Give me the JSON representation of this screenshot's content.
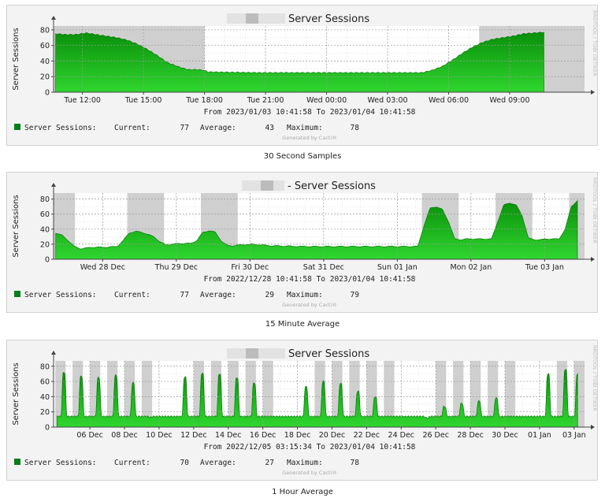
{
  "colors": {
    "area_light": "#2fd62f",
    "area_dark": "#0a8f0a",
    "legend_swatch": "#00801a",
    "night_shade": "#cfcfcf",
    "grid": "#bdbdbd",
    "axis": "#444444"
  },
  "chart_data": [
    {
      "type": "area",
      "title": "Server Sessions",
      "ylabel": "Server Sessions",
      "side_label": "RRDTOOL / TOBI OETIKER",
      "ylim": [
        0,
        85
      ],
      "yticks": [
        0,
        20,
        40,
        60,
        80
      ],
      "xlim_hours": [
        -24.1,
        2.0
      ],
      "xticks": [
        {
          "t": -22.68,
          "label": "Tue 12:00"
        },
        {
          "t": -19.68,
          "label": "Tue 15:00"
        },
        {
          "t": -16.68,
          "label": "Tue 18:00"
        },
        {
          "t": -13.68,
          "label": "Tue 21:00"
        },
        {
          "t": -10.68,
          "label": "Wed 00:00"
        },
        {
          "t": -7.68,
          "label": "Wed 03:00"
        },
        {
          "t": -4.68,
          "label": "Wed 06:00"
        },
        {
          "t": -1.68,
          "label": "Wed 09:00"
        }
      ],
      "minor_step": 1,
      "shade": [
        [
          -24.1,
          -16.68
        ],
        [
          -3.18,
          2.0
        ]
      ],
      "series": [
        {
          "x": [
            -24.0,
            -23.5,
            -23.0,
            -22.5,
            -22.0,
            -21.5,
            -21.0,
            -20.5,
            -20.0,
            -19.5,
            -19.0,
            -18.5,
            -18.0,
            -17.5,
            -17.0,
            -16.7,
            -16.5,
            -14.0,
            -11.0,
            -8.0,
            -6.5,
            -6.0,
            -5.5,
            -5.0,
            -4.5,
            -4.0,
            -3.5,
            -3.0,
            -2.5,
            -2.0,
            -1.5,
            -1.0,
            0.0
          ],
          "values": [
            75,
            74,
            74,
            76,
            74,
            72,
            70,
            67,
            62,
            55,
            47,
            38,
            33,
            29,
            29,
            28,
            26,
            25,
            25,
            25,
            25,
            25,
            28,
            33,
            41,
            50,
            58,
            64,
            68,
            70,
            72,
            75,
            77
          ]
        }
      ],
      "range_text": "From 2023/01/03 10:41:58 To 2023/01/04 10:41:58",
      "legend": {
        "name": "Server Sessions:",
        "current_label": "Current:",
        "current": "77",
        "average_label": "Average:",
        "average": "43",
        "maximum_label": "Maximum:",
        "maximum": "78"
      },
      "generated": "Generated by Cacti®",
      "caption": "30 Second Samples"
    },
    {
      "type": "area",
      "title": "- Server Sessions",
      "ylabel": "Server Sessions",
      "side_label": "RRDTOOL / TOBI OETIKER",
      "ylim": [
        0,
        88
      ],
      "yticks": [
        0,
        20,
        40,
        60,
        80
      ],
      "xlim_hours": [
        -170.7,
        2.3
      ],
      "xticks": [
        {
          "t": -154.7,
          "label": "Wed 28 Dec"
        },
        {
          "t": -130.7,
          "label": "Thu 29 Dec"
        },
        {
          "t": -106.7,
          "label": "Fri 30 Dec"
        },
        {
          "t": -82.7,
          "label": "Sat 31 Dec"
        },
        {
          "t": -58.7,
          "label": "Sun 01 Jan"
        },
        {
          "t": -34.7,
          "label": "Mon 02 Jan"
        },
        {
          "t": -10.7,
          "label": "Tue 03 Jan"
        }
      ],
      "minor_step": 6,
      "shade": [
        [
          -170.7,
          -163.7
        ],
        [
          -146.7,
          -134.7
        ],
        [
          -122.7,
          -110.7
        ],
        [
          -50.7,
          -38.7
        ],
        [
          -26.7,
          -14.7
        ],
        [
          -2.7,
          2.3
        ]
      ],
      "series": [
        {
          "x": [
            -170,
            -168,
            -166,
            -164,
            -162,
            -160,
            -158,
            -154,
            -150,
            -148,
            -146,
            -144,
            -142,
            -140,
            -138,
            -136,
            -134,
            -132,
            -130,
            -126,
            -124,
            -122,
            -120,
            -118,
            -116,
            -114,
            -112,
            -110,
            -106,
            -100,
            -90,
            -80,
            -70,
            -60,
            -52,
            -50,
            -48,
            -46,
            -44,
            -42,
            -40,
            -38,
            -36,
            -32,
            -28,
            -26,
            -24,
            -22,
            -20,
            -18,
            -16,
            -14,
            -12,
            -10,
            -8,
            -6,
            -4,
            -2,
            0
          ],
          "values": [
            35,
            32,
            25,
            17,
            14,
            15,
            16,
            16,
            17,
            25,
            35,
            37,
            36,
            33,
            30,
            23,
            19,
            20,
            21,
            21,
            25,
            36,
            38,
            36,
            24,
            18,
            18,
            19,
            20,
            18,
            17,
            17,
            17,
            17,
            17,
            45,
            68,
            70,
            66,
            50,
            27,
            26,
            27,
            27,
            27,
            50,
            72,
            75,
            72,
            58,
            28,
            26,
            26,
            27,
            27,
            27,
            40,
            70,
            78
          ]
        }
      ],
      "range_text": "From 2022/12/28 10:41:58 To 2023/01/04 10:41:58",
      "legend": {
        "name": "Server Sessions:",
        "current_label": "Current:",
        "current": "77",
        "average_label": "Average:",
        "average": "29",
        "maximum_label": "Maximum:",
        "maximum": "79"
      },
      "generated": "Generated by Cacti®",
      "caption": "15 Minute Average"
    },
    {
      "type": "area",
      "title": "Server Sessions",
      "ylabel": "Server Sessions",
      "side_label": "RRDTOOL / TOBI OETIKER",
      "ylim": [
        0,
        87
      ],
      "yticks": [
        0,
        20,
        40,
        60,
        80
      ],
      "xlim_days": [
        -30.3,
        0.4
      ],
      "xticks": [
        {
          "t": -28.2,
          "label": "06 Dec"
        },
        {
          "t": -26.2,
          "label": "08 Dec"
        },
        {
          "t": -24.2,
          "label": "10 Dec"
        },
        {
          "t": -22.2,
          "label": "12 Dec"
        },
        {
          "t": -20.2,
          "label": "14 Dec"
        },
        {
          "t": -18.2,
          "label": "16 Dec"
        },
        {
          "t": -16.2,
          "label": "18 Dec"
        },
        {
          "t": -14.2,
          "label": "20 Dec"
        },
        {
          "t": -12.2,
          "label": "22 Dec"
        },
        {
          "t": -10.2,
          "label": "24 Dec"
        },
        {
          "t": -8.2,
          "label": "26 Dec"
        },
        {
          "t": -6.2,
          "label": "28 Dec"
        },
        {
          "t": -4.2,
          "label": "30 Dec"
        },
        {
          "t": -2.2,
          "label": "01 Jan"
        },
        {
          "t": -0.2,
          "label": "03 Jan"
        }
      ],
      "minor_step": 1,
      "shade": [
        [
          -30.2,
          -29.6
        ],
        [
          -29.2,
          -28.6
        ],
        [
          -28.2,
          -27.6
        ],
        [
          -27.2,
          -26.6
        ],
        [
          -26.2,
          -25.6
        ],
        [
          -25.2,
          -24.6
        ],
        [
          -22.2,
          -21.6
        ],
        [
          -21.2,
          -20.6
        ],
        [
          -20.2,
          -19.6
        ],
        [
          -19.2,
          -18.6
        ],
        [
          -18.2,
          -17.6
        ],
        [
          -15.2,
          -14.6
        ],
        [
          -14.2,
          -13.6
        ],
        [
          -13.2,
          -12.6
        ],
        [
          -12.2,
          -11.6
        ],
        [
          -11.2,
          -10.6
        ],
        [
          -8.2,
          -7.6
        ],
        [
          -7.2,
          -6.6
        ],
        [
          -6.2,
          -5.6
        ],
        [
          -5.2,
          -4.6
        ],
        [
          -4.2,
          -3.6
        ],
        [
          -1.2,
          -0.6
        ],
        [
          -0.2,
          0.4
        ]
      ],
      "series": [
        {
          "peaks_t": [
            -29.7,
            -28.7,
            -27.7,
            -26.7,
            -25.7,
            -24.7,
            -22.7,
            -21.7,
            -20.7,
            -19.7,
            -18.7,
            -15.7,
            -14.7,
            -13.7,
            -12.7,
            -11.7,
            -8.7,
            -7.7,
            -6.7,
            -5.7,
            -4.7,
            -1.7,
            -0.7,
            0.0
          ],
          "peaks_v": [
            72,
            67,
            65,
            68,
            58,
            13,
            66,
            71,
            70,
            65,
            58,
            53,
            60,
            57,
            47,
            40,
            12,
            27,
            31,
            34,
            38,
            70,
            76,
            70
          ],
          "base": 14,
          "t_start": -30.1,
          "t_end": 0.0
        }
      ],
      "range_text": "From 2022/12/05 03:15:34 To 2023/01/04 10:41:58",
      "legend": {
        "name": "Server Sessions:",
        "current_label": "Current:",
        "current": "70",
        "average_label": "Average:",
        "average": "27",
        "maximum_label": "Maximum:",
        "maximum": "78"
      },
      "generated": "Generated by Cacti®",
      "caption": "1 Hour Average"
    }
  ]
}
